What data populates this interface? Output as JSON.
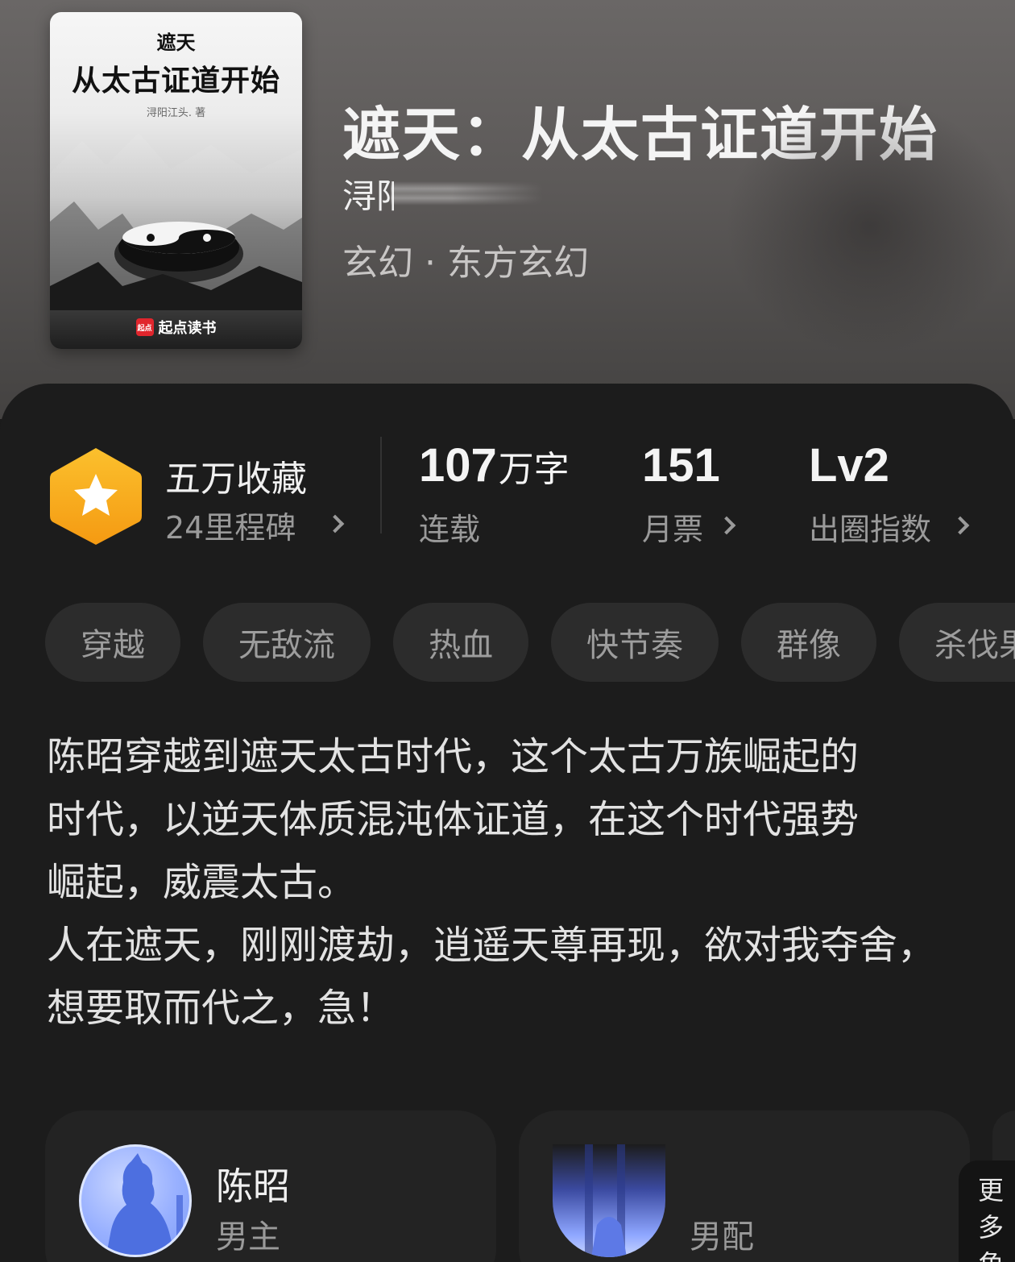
{
  "cover": {
    "subtitle": "遮天",
    "title": "从太古证道开始",
    "author_small": "浔阳江头. 著",
    "brand": "起点读书",
    "brand_logo": "起点"
  },
  "book": {
    "title": "遮天：从太古证道开始",
    "author": "浔阳",
    "genre": "玄幻 · 东方玄幻"
  },
  "stats": {
    "favorites_title": "五万收藏",
    "milestones_label": "24里程碑",
    "word_count_value": "107",
    "word_count_unit": "万字",
    "status_label": "连载",
    "monthly_votes_value": "151",
    "monthly_votes_label": "月票",
    "circle_index_value": "Lv2",
    "circle_index_label": "出圈指数",
    "badge_color": "#f6a821"
  },
  "tags": [
    "穿越",
    "无敌流",
    "热血",
    "快节奏",
    "群像",
    "杀伐果断"
  ],
  "synopsis": "陈昭穿越到遮天太古时代，这个太古万族崛起的\n时代，以逆天体质混沌体证道，在这个时代强势\n崛起，威震太古。\n人在遮天，刚刚渡劫，逍遥天尊再现，欲对我夺舍，\n想要取而代之，急！",
  "characters": [
    {
      "name": "陈昭",
      "role": "男主"
    },
    {
      "name": "",
      "role": "男配"
    }
  ],
  "more_button": "更\n多\n角"
}
